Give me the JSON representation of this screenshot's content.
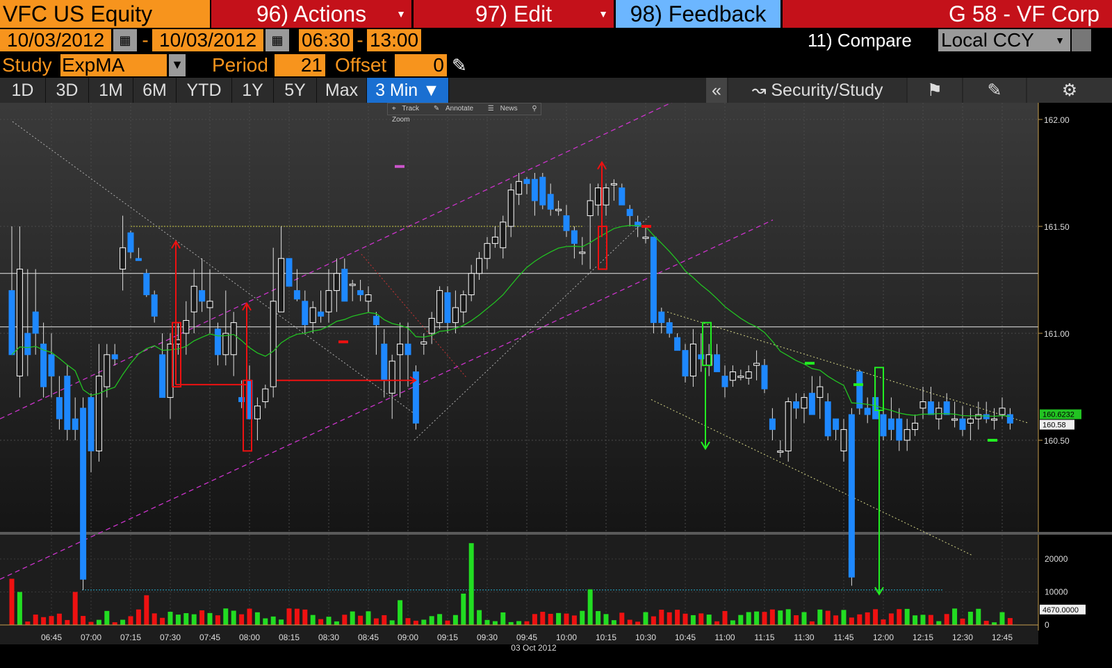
{
  "header": {
    "security": "VFC US Equity",
    "actions_label": "96) Actions",
    "edit_label": "97) Edit",
    "feedback_label": "98) Feedback",
    "page_title": "G 58 - VF Corp"
  },
  "range": {
    "start_date": "10/03/2012",
    "separator": "-",
    "end_date": "10/03/2012",
    "start_time": "06:30",
    "time_separator": "-",
    "end_time": "13:00",
    "compare_label": "11) Compare",
    "currency": "Local CCY"
  },
  "study": {
    "label": "Study",
    "value": "ExpMA",
    "period_label": "Period",
    "period_value": "21",
    "offset_label": "Offset",
    "offset_value": "0"
  },
  "tabs": [
    {
      "label": "1D"
    },
    {
      "label": "3D"
    },
    {
      "label": "1M"
    },
    {
      "label": "6M"
    },
    {
      "label": "YTD"
    },
    {
      "label": "1Y"
    },
    {
      "label": "5Y"
    },
    {
      "label": "Max"
    },
    {
      "label": "3 Min ▼",
      "active": true
    }
  ],
  "toolbar": {
    "collapse": "«",
    "security_study": "Security/Study",
    "mini_track": "Track",
    "mini_annotate": "Annotate",
    "mini_news": "News",
    "mini_zoom": "Zoom"
  },
  "colors": {
    "up": "#1e88ff",
    "down_outline": "#ffffff",
    "ema": "#22c322",
    "vol_up": "#22dd22",
    "vol_down": "#ee1111",
    "orange": "#f7941d",
    "red_bar": "#c4111a",
    "annot_red": "#ee1111",
    "annot_green": "#22ee22",
    "channel": "#cc33cc"
  },
  "chart_data": {
    "type": "candlestick",
    "title": "",
    "x_date_label": "03 Oct 2012",
    "price_ticks": [
      "162.00",
      "161.50",
      "161.00",
      "160.50"
    ],
    "price_ylim": [
      159.95,
      162.1
    ],
    "last_price_label": "160.6232",
    "ema_value_label": "160.58",
    "volume_ticks": [
      "20000",
      "10000",
      "0"
    ],
    "volume_last_label": "4670.0000",
    "volume_ylim": [
      0,
      26000
    ],
    "x_ticks": [
      "06:45",
      "07:00",
      "07:15",
      "07:30",
      "07:45",
      "08:00",
      "08:15",
      "08:30",
      "08:45",
      "09:00",
      "09:15",
      "09:30",
      "09:45",
      "10:00",
      "10:15",
      "10:30",
      "10:45",
      "11:00",
      "11:15",
      "11:30",
      "11:45",
      "12:00",
      "12:15",
      "12:30",
      "12:45"
    ],
    "horizontal_lines": [
      161.28,
      161.03
    ],
    "support_line": 159.8,
    "resistance_line": 161.5
  }
}
